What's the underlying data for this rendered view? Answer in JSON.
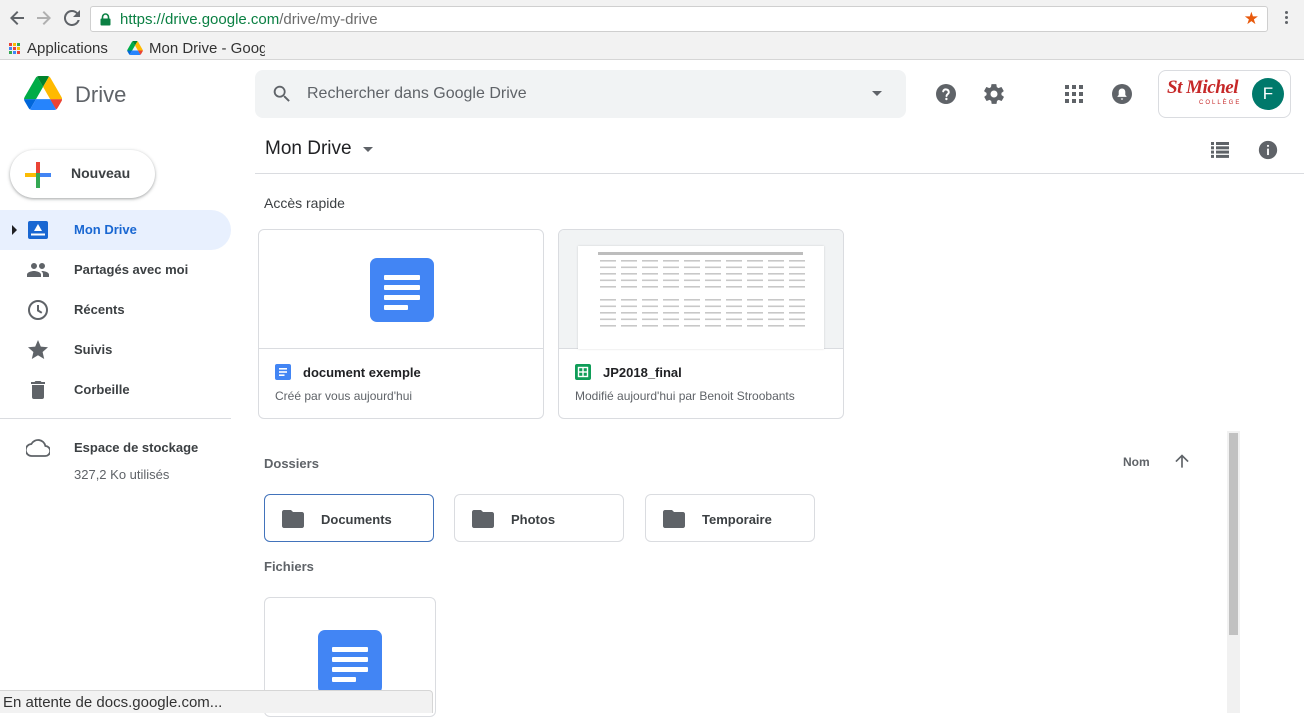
{
  "browser": {
    "url_host": "https://drive.google.com",
    "url_path": "/drive/my-drive",
    "bookmarks": [
      {
        "label": "Applications"
      },
      {
        "label": "Mon Drive - Goog"
      }
    ],
    "status": "En attente de docs.google.com..."
  },
  "header": {
    "app_name": "Drive",
    "search_placeholder": "Rechercher dans Google Drive",
    "account": {
      "brand": "St Michel",
      "brand_sub": "COLLÈGE",
      "avatar_letter": "F"
    }
  },
  "sidebar": {
    "new_button": "Nouveau",
    "items": [
      {
        "label": "Mon Drive",
        "icon": "my-drive-icon",
        "active": true
      },
      {
        "label": "Partagés avec moi",
        "icon": "shared-people-icon"
      },
      {
        "label": "Récents",
        "icon": "clock-icon"
      },
      {
        "label": "Suivis",
        "icon": "star-icon"
      },
      {
        "label": "Corbeille",
        "icon": "trash-icon"
      }
    ],
    "storage": {
      "title": "Espace de stockage",
      "used": "327,2 Ko utilisés"
    }
  },
  "main": {
    "title": "Mon Drive",
    "quick_access": {
      "label": "Accès rapide",
      "cards": [
        {
          "name": "document exemple",
          "desc": "Créé par vous aujourd'hui",
          "type": "doc"
        },
        {
          "name": "JP2018_final",
          "desc": "Modifié aujourd'hui par Benoit Stroobants",
          "type": "sheet"
        }
      ]
    },
    "folders": {
      "label": "Dossiers",
      "sort_label": "Nom",
      "items": [
        {
          "name": "Documents",
          "selected": true
        },
        {
          "name": "Photos"
        },
        {
          "name": "Temporaire"
        }
      ]
    },
    "files": {
      "label": "Fichiers"
    }
  },
  "colors": {
    "accent_blue": "#1967d2",
    "docs_blue": "#4285f4",
    "sheets_green": "#0f9d58",
    "active_nav_bg": "#e8f0fe"
  }
}
